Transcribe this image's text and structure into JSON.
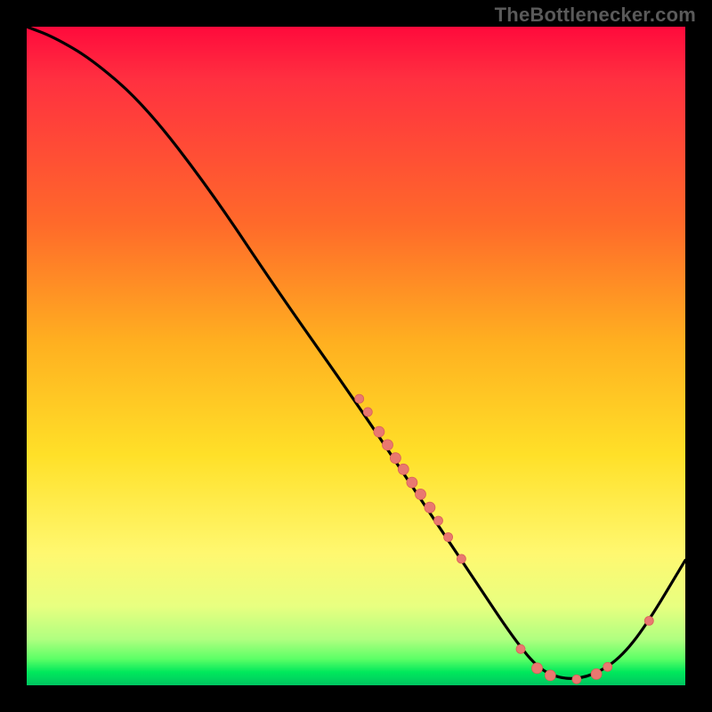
{
  "watermark_text": "TheBottlenecker.com",
  "colors": {
    "curve_stroke": "#000000",
    "point_fill": "#e97870",
    "point_stroke": "#da6058",
    "frame_bg": "#000000"
  },
  "chart_data": {
    "type": "line",
    "title": "",
    "xlabel": "",
    "ylabel": "",
    "xlim": [
      0,
      100
    ],
    "ylim": [
      0,
      100
    ],
    "curve": [
      {
        "x": 0,
        "y": 100
      },
      {
        "x": 4,
        "y": 98.5
      },
      {
        "x": 10,
        "y": 95
      },
      {
        "x": 18,
        "y": 88
      },
      {
        "x": 28,
        "y": 75
      },
      {
        "x": 38,
        "y": 60
      },
      {
        "x": 50,
        "y": 43
      },
      {
        "x": 60,
        "y": 28
      },
      {
        "x": 68,
        "y": 16
      },
      {
        "x": 74,
        "y": 7
      },
      {
        "x": 78,
        "y": 2.2
      },
      {
        "x": 82,
        "y": 0.8
      },
      {
        "x": 86,
        "y": 1.5
      },
      {
        "x": 90,
        "y": 4
      },
      {
        "x": 94,
        "y": 9
      },
      {
        "x": 100,
        "y": 19
      }
    ],
    "scatter_points": [
      {
        "x": 50.5,
        "y": 43.5,
        "r": 5
      },
      {
        "x": 51.8,
        "y": 41.5,
        "r": 5
      },
      {
        "x": 53.5,
        "y": 38.5,
        "r": 6
      },
      {
        "x": 54.8,
        "y": 36.5,
        "r": 6
      },
      {
        "x": 56.0,
        "y": 34.5,
        "r": 6
      },
      {
        "x": 57.2,
        "y": 32.8,
        "r": 6
      },
      {
        "x": 58.5,
        "y": 30.8,
        "r": 6
      },
      {
        "x": 59.8,
        "y": 29.0,
        "r": 6
      },
      {
        "x": 61.2,
        "y": 27.0,
        "r": 6
      },
      {
        "x": 62.5,
        "y": 25.0,
        "r": 5
      },
      {
        "x": 64.0,
        "y": 22.5,
        "r": 5
      },
      {
        "x": 66.0,
        "y": 19.2,
        "r": 5
      },
      {
        "x": 75.0,
        "y": 5.5,
        "r": 5
      },
      {
        "x": 77.5,
        "y": 2.6,
        "r": 6
      },
      {
        "x": 79.5,
        "y": 1.5,
        "r": 6
      },
      {
        "x": 83.5,
        "y": 0.9,
        "r": 5
      },
      {
        "x": 86.5,
        "y": 1.7,
        "r": 6
      },
      {
        "x": 88.2,
        "y": 2.8,
        "r": 5
      },
      {
        "x": 94.5,
        "y": 9.8,
        "r": 5
      }
    ]
  }
}
